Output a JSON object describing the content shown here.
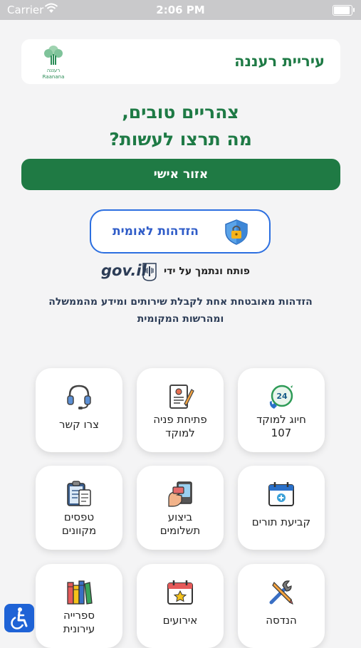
{
  "status_bar": {
    "carrier": "Carrier",
    "time": "2:06 PM"
  },
  "header": {
    "title": "עיריית רעננה",
    "logo_text_he": "רעננה",
    "logo_text_en": "Raanana"
  },
  "greeting": {
    "line1": "צהריים טובים,",
    "line2": "מה תרצו לעשות?"
  },
  "personal_area_button": "אזור אישי",
  "national_id": {
    "label": "הזדהות לאומית",
    "powered_by": "פותח ונתמך על ידי",
    "gov_logo": "gov.il"
  },
  "description": {
    "line1": "הזדהות מאובטחת אחת לקבלת שירותים ומידע מהממשלה",
    "line2": "ומהרשות המקומית"
  },
  "tiles": [
    {
      "name": "call-hotline",
      "line1": "חיוג למוקד",
      "line2": "107",
      "icon": "phone-24-icon"
    },
    {
      "name": "open-request",
      "line1": "פתיחת פניה",
      "line2": "למוקד",
      "icon": "request-form-icon"
    },
    {
      "name": "contact-us",
      "line1": "צרו קשר",
      "line2": "",
      "icon": "headset-icon"
    },
    {
      "name": "appointments",
      "line1": "קביעת תורים",
      "line2": "",
      "icon": "calendar-plus-icon"
    },
    {
      "name": "payments",
      "line1": "ביצוע",
      "line2": "תשלומים",
      "icon": "payment-card-icon"
    },
    {
      "name": "online-forms",
      "line1": "טפסים",
      "line2": "מקוונים",
      "icon": "clipboard-forms-icon"
    },
    {
      "name": "engineering",
      "line1": "הנדסה",
      "line2": "",
      "icon": "tools-icon"
    },
    {
      "name": "events",
      "line1": "אירועים",
      "line2": "",
      "icon": "calendar-star-icon"
    },
    {
      "name": "library",
      "line1": "ספרייה",
      "line2": "עירונית",
      "icon": "books-icon"
    }
  ],
  "colors": {
    "brand_green": "#1f7a44",
    "id_blue": "#2c6fe0",
    "accessibility_blue": "#1f63d6"
  }
}
